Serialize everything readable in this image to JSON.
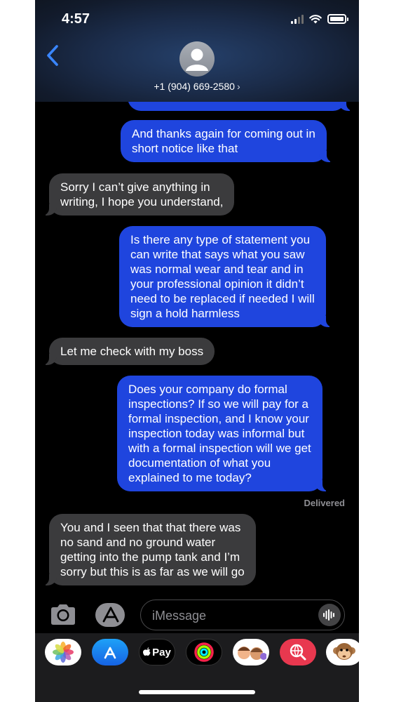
{
  "status_bar": {
    "time": "4:57"
  },
  "header": {
    "contact": "+1 (904) 669-2580",
    "chevron": "›",
    "back_icon": "chevron-left-icon"
  },
  "messages": [
    {
      "type": "sent",
      "lines": [
        "And thanks again for coming out in",
        "short notice like that"
      ]
    },
    {
      "type": "received",
      "lines": [
        "Sorry I can’t give anything in",
        "writing, I hope you understand,"
      ]
    },
    {
      "type": "sent",
      "lines": [
        "Is there any type of statement you",
        "can write that says what you saw",
        "was normal wear and tear and in",
        "your professional opinion it didn’t",
        "need to be replaced if needed I will",
        "sign a hold harmless"
      ]
    },
    {
      "type": "received",
      "lines": [
        "Let me check with my boss"
      ]
    },
    {
      "type": "sent",
      "lines": [
        "Does your company do formal",
        "inspections? If so we will pay for a",
        "formal inspection, and I know your",
        "inspection today was informal but",
        "with a formal inspection will we get",
        "documentation of what you",
        "explained to me today?"
      ]
    },
    {
      "type": "received",
      "lines": [
        "You and I seen that that there was",
        "no sand and no ground water",
        "getting into the pump tank and I’m",
        "sorry but this is as far as we will go"
      ]
    }
  ],
  "delivery_status": "Delivered",
  "composer": {
    "placeholder": "iMessage"
  },
  "app_tray": [
    {
      "name": "photos",
      "icon": "photos-icon"
    },
    {
      "name": "app-store",
      "icon": "app-store-icon"
    },
    {
      "name": "apple-pay",
      "icon": "apple-pay-icon",
      "label": "Pay"
    },
    {
      "name": "activity",
      "icon": "activity-rings-icon"
    },
    {
      "name": "memoji-stickers",
      "icon": "memoji-icon"
    },
    {
      "name": "images-search",
      "icon": "globe-search-icon"
    },
    {
      "name": "animoji",
      "icon": "monkey-icon"
    }
  ],
  "colors": {
    "sent_bubble": "#1f45de",
    "received_bubble": "#3b3b3d",
    "background": "#000000"
  }
}
